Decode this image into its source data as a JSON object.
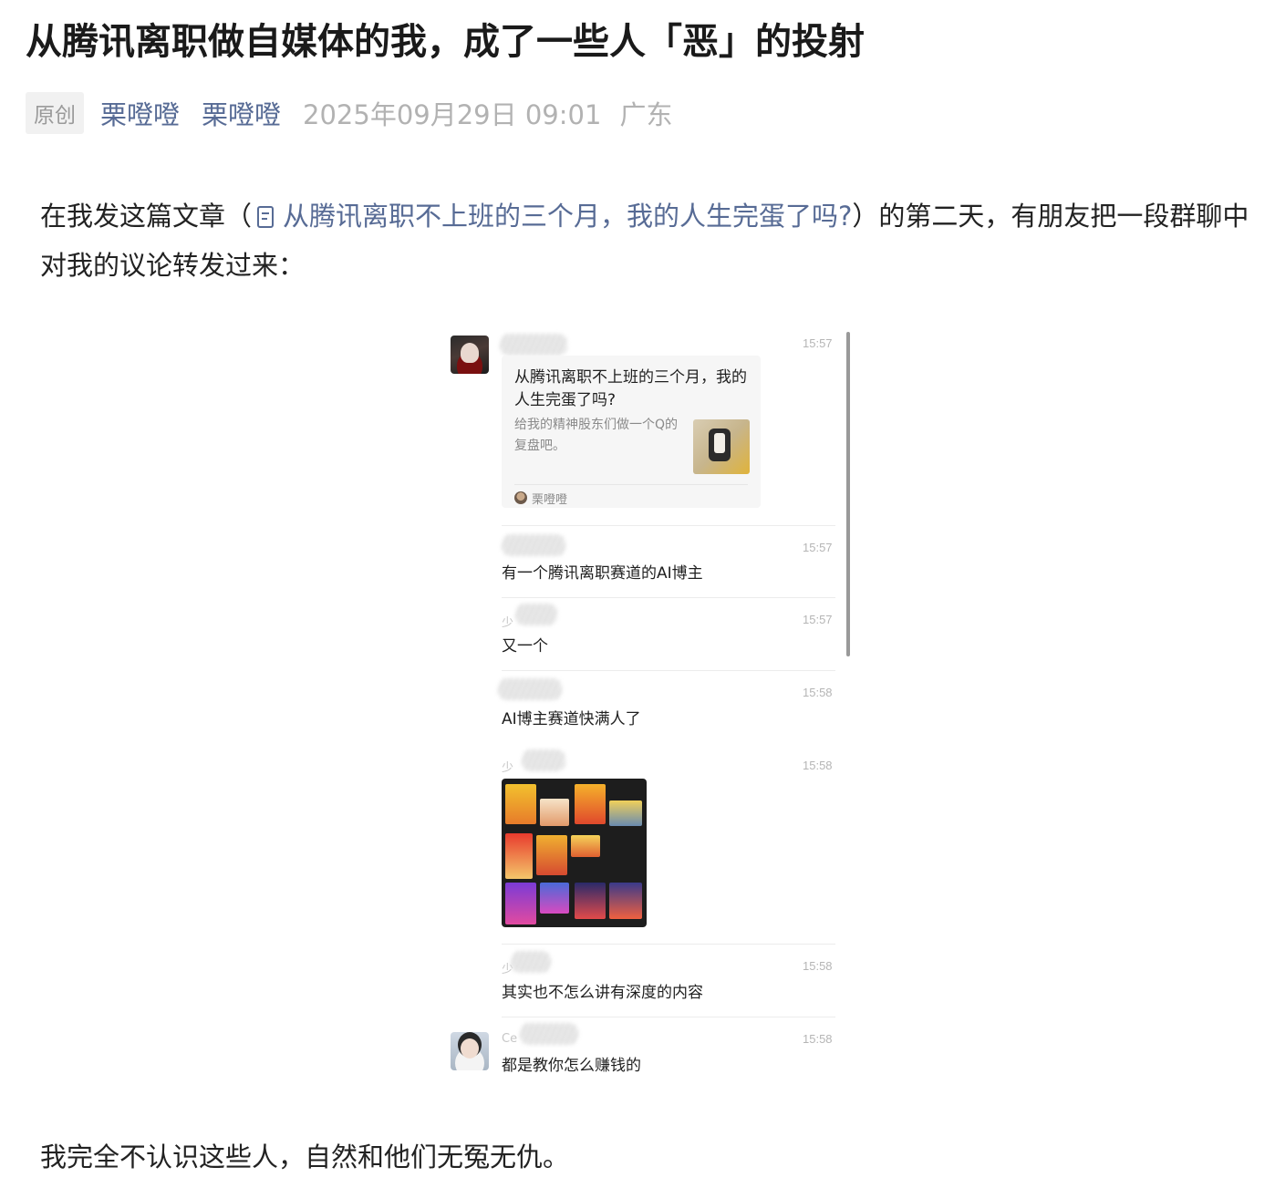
{
  "article": {
    "title": "从腾讯离职做自媒体的我，成了一些人「恶」的投射",
    "badge": "原创",
    "author_1": "栗噔噔",
    "author_2": "栗噔噔",
    "datetime": "2025年09月29日 09:01",
    "location": "广东"
  },
  "paragraph_1": {
    "before_link": "在我发这篇文章（",
    "link_text": "从腾讯离职不上班的三个月，我的人生完蛋了吗?",
    "after_link": "）的第二天，有朋友把一段群聊中对我的议论转发过来："
  },
  "paragraph_2": "我完全不认识这些人，自然和他们无冤无仇。",
  "chat": {
    "card": {
      "title": "从腾讯离职不上班的三个月，我的人生完蛋了吗?",
      "description": "给我的精神股东们做一个Q的复盘吧。",
      "source": "栗噔噔",
      "time": "15:57"
    },
    "messages": [
      {
        "time": "15:57",
        "text": "有一个腾讯离职赛道的AI博主",
        "name_fragment": ""
      },
      {
        "time": "15:57",
        "text": "又一个",
        "name_fragment": "少"
      },
      {
        "time": "15:58",
        "text": "AI博主赛道快满人了",
        "name_fragment": ""
      },
      {
        "time": "15:58",
        "text": "",
        "name_fragment": "少"
      },
      {
        "time": "15:58",
        "text": "其实也不怎么讲有深度的内容",
        "name_fragment": "少"
      },
      {
        "time": "15:58",
        "text": "都是教你怎么赚钱的",
        "name_fragment": "Ce"
      }
    ]
  },
  "colors": {
    "link": "#576b95",
    "meta_gray": "#b2b2b2",
    "badge_bg": "#f1f1f1"
  }
}
